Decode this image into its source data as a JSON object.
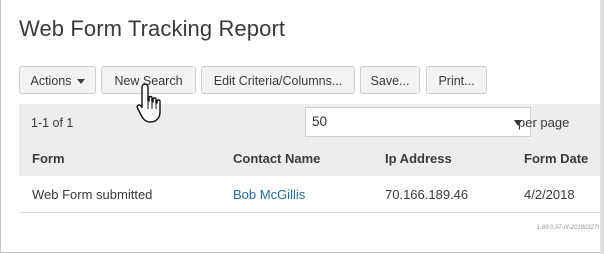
{
  "page": {
    "title": "Web Form Tracking Report"
  },
  "toolbar": {
    "actions_label": "Actions",
    "new_search_label": "New Search",
    "edit_criteria_label": "Edit Criteria/Columns...",
    "save_label": "Save...",
    "print_label": "Print..."
  },
  "pagination": {
    "count": "1-1 of 1",
    "per_page_value": "50",
    "per_page_label": "per page"
  },
  "table": {
    "columns": [
      "Form",
      "Contact Name",
      "Ip Address",
      "Form Date"
    ],
    "rows": [
      {
        "form": "Web Form submitted",
        "contact": "Bob McGillis",
        "ip": "70.166.189.46",
        "date": "4/2/2018"
      }
    ]
  },
  "footer": {
    "version": "1.69.0.97-rif-20180327t"
  },
  "colors": {
    "link": "#2a6ea6",
    "band": "#ededed",
    "button_bg": "#f3f3f3"
  },
  "icons": {
    "cursor": "hand-pointer-icon",
    "actions_caret": "caret-down-icon",
    "select_arrow": "triangle-down-icon"
  }
}
